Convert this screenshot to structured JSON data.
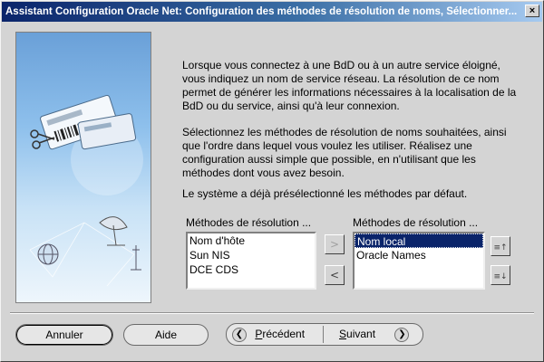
{
  "window": {
    "title": "Assistant Configuration Oracle Net: Configuration des méthodes de résolution de noms, Sélectionner...",
    "close_glyph": "×"
  },
  "intro": {
    "paragraph1": "Lorsque vous connectez à une BdD ou à un autre service éloigné, vous indiquez un nom de service réseau. La résolution de ce nom permet de générer les informations nécessaires à la localisation de la BdD ou du service, ainsi qu'à leur connexion.",
    "paragraph2": "Sélectionnez les méthodes de résolution de noms souhaitées, ainsi que l'ordre dans lequel vous voulez les utiliser. Réalisez une configuration aussi simple que possible, en n'utilisant que les méthodes dont vous avez besoin.",
    "paragraph3": "Le système a déjà présélectionné les méthodes par défaut."
  },
  "available": {
    "label": "Méthodes de résolution ...",
    "items": [
      "Nom d'hôte",
      "Sun NIS",
      "DCE CDS"
    ]
  },
  "selected": {
    "label": "Méthodes de résolution ...",
    "items": [
      "Nom local",
      "Oracle Names"
    ],
    "selected_item": "Nom local"
  },
  "transfer_buttons": {
    "add_glyph": ">",
    "remove_glyph": "<"
  },
  "order_buttons": {
    "up_glyph": "≡↑",
    "down_glyph": "≡↓"
  },
  "footer": {
    "cancel": "Annuler",
    "help": "Aide",
    "back_prefix": "",
    "back_mnemonic": "P",
    "back_rest": "récédent",
    "next_mnemonic": "S",
    "next_rest": "uivant",
    "back_chevron": "❮",
    "next_chevron": "❯"
  },
  "colors": {
    "title_gradient_start": "#0a246a",
    "selection": "#0a246a",
    "dialog_bg": "#d4d4d4"
  }
}
